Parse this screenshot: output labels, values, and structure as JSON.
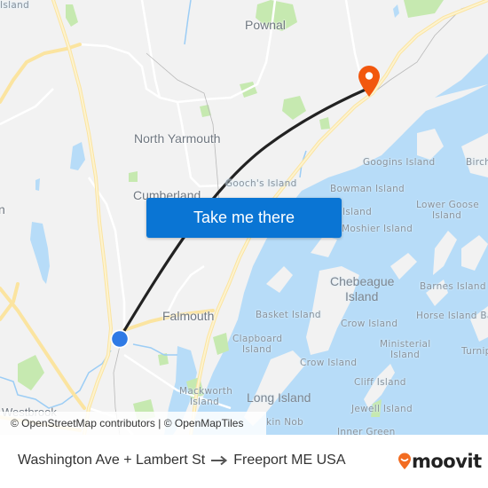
{
  "map": {
    "town_labels": [
      {
        "id": "pownal",
        "text": "Pownal"
      },
      {
        "id": "north-yarmouth",
        "text": "North Yarmouth"
      },
      {
        "id": "cumberland",
        "text": "Cumberland"
      },
      {
        "id": "falmouth",
        "text": "Falmouth"
      },
      {
        "id": "westbrook",
        "text": "Westbrook"
      }
    ],
    "island_labels": [
      {
        "id": "island-top-left",
        "text": "Island"
      },
      {
        "id": "googins",
        "text": "Googins Island"
      },
      {
        "id": "birch",
        "text": "Birch"
      },
      {
        "id": "goochs",
        "text": "Gooch's Island"
      },
      {
        "id": "bowman",
        "text": "Bowman Island"
      },
      {
        "id": "island-partial",
        "text": "Island"
      },
      {
        "id": "lower-goose-1",
        "text": "Lower Goose"
      },
      {
        "id": "lower-goose-2",
        "text": "Island"
      },
      {
        "id": "moshier",
        "text": "Moshier Island"
      },
      {
        "id": "chebeague-1",
        "text": "Chebeague"
      },
      {
        "id": "chebeague-2",
        "text": "Island"
      },
      {
        "id": "barnes",
        "text": "Barnes Island"
      },
      {
        "id": "basket",
        "text": "Basket Island"
      },
      {
        "id": "horse",
        "text": "Horse Island Ba"
      },
      {
        "id": "crow-1",
        "text": "Crow Island"
      },
      {
        "id": "clapboard-1",
        "text": "Clapboard"
      },
      {
        "id": "clapboard-2",
        "text": "Island"
      },
      {
        "id": "ministerial-1",
        "text": "Ministerial"
      },
      {
        "id": "ministerial-2",
        "text": "Island"
      },
      {
        "id": "turnip",
        "text": "Turnip"
      },
      {
        "id": "crow-2",
        "text": "Crow Island"
      },
      {
        "id": "cliff",
        "text": "Cliff Island"
      },
      {
        "id": "mackworth-1",
        "text": "Mackworth"
      },
      {
        "id": "mackworth-2",
        "text": "Island"
      },
      {
        "id": "long",
        "text": "Long Island"
      },
      {
        "id": "jewell",
        "text": "Jewell Island"
      },
      {
        "id": "nob",
        "text": "kin Nob"
      },
      {
        "id": "inner-green",
        "text": "Inner Green"
      },
      {
        "id": "left-edge",
        "text": "n"
      }
    ],
    "cta_label": "Take me there",
    "attribution": "© OpenStreetMap contributors | © OpenMapTiles",
    "origin_marker_color": "#2f7ae5",
    "destination_marker_color": "#f2570d",
    "route_color": "#222222",
    "water_color": "#b7dcf8",
    "land_color": "#f2f2f2",
    "park_color": "#c6e9b0",
    "highway_color": "#fbe9a4"
  },
  "footer": {
    "origin": "Washington Ave + Lambert St",
    "destination": "Freeport ME USA",
    "brand": "moovit",
    "brand_color": "#f26c21"
  }
}
